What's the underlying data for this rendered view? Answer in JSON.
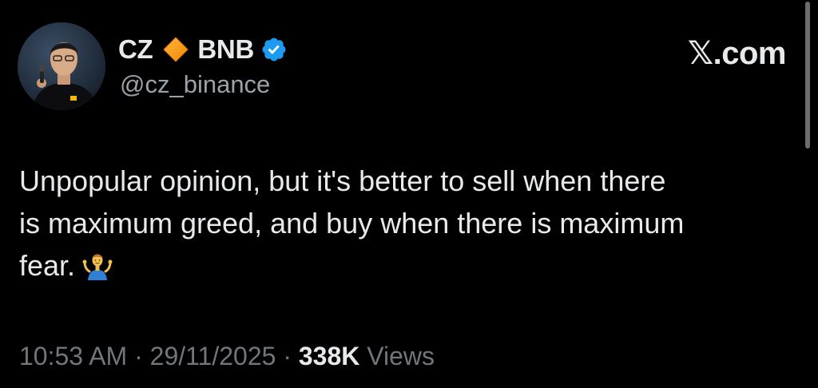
{
  "header": {
    "display_name_part1": "CZ",
    "display_name_part2": "BNB",
    "handle": "@cz_binance",
    "brand": "𝕏.com",
    "icons": {
      "avatar": "profile-photo",
      "badge_1": "orange-diamond-icon",
      "badge_2": "verified-icon"
    }
  },
  "tweet": {
    "line1": "Unpopular opinion, but it's better to sell when there",
    "line2": "is maximum greed, and buy when there is maximum",
    "line3": "fear.",
    "emoji": "shrug-icon"
  },
  "meta": {
    "time": "10:53 AM",
    "separator": "·",
    "date": "29/11/2025",
    "views_count": "338K",
    "views_label": "Views"
  },
  "colors": {
    "background": "#000000",
    "text": "#e7e9ea",
    "secondary": "#71767b",
    "verified": "#1d9bf0",
    "diamond": "#f7931a"
  }
}
